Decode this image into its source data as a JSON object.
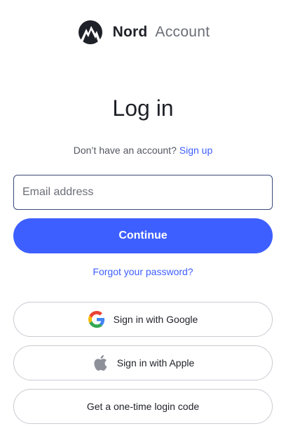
{
  "brand": {
    "name": "Nord",
    "product": "Account",
    "logo_icon": "nord-mountain-logo-icon"
  },
  "page": {
    "title": "Log in",
    "signup_prompt": "Don’t have an account?",
    "signup_link": "Sign up"
  },
  "form": {
    "email_placeholder": "Email address",
    "email_value": "",
    "continue_label": "Continue",
    "forgot_label": "Forgot your password?"
  },
  "alternatives": {
    "google_label": "Sign in with Google",
    "google_icon": "google-icon",
    "apple_label": "Sign in with Apple",
    "apple_icon": "apple-icon",
    "otc_label": "Get a one-time login code"
  },
  "colors": {
    "accent": "#3e5fff",
    "text": "#1f2128",
    "muted": "#6b6e78",
    "border": "#c9cbd1",
    "focus_border": "#3b4a7a"
  }
}
